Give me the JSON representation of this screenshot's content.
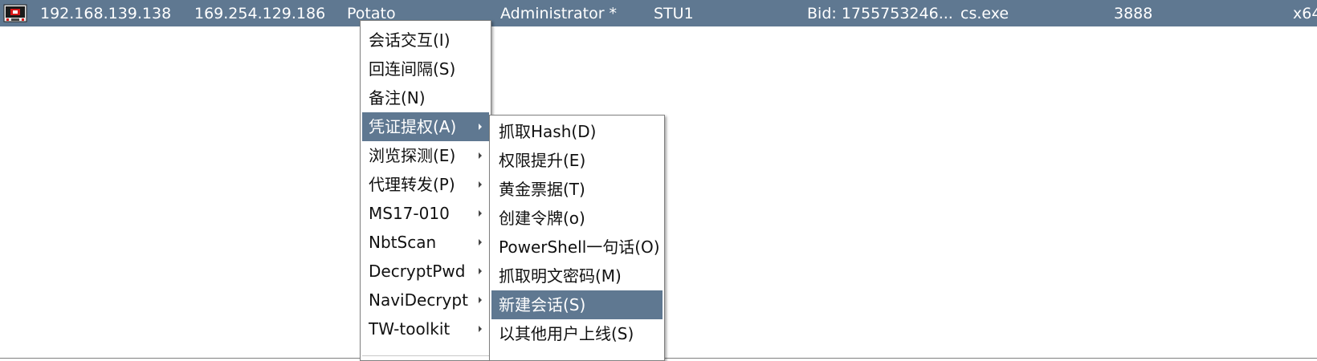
{
  "colors": {
    "selection": "#5f7891",
    "menu_background": "#ffffff",
    "menu_border": "#808080"
  },
  "session": {
    "icon": "computer-icon",
    "external_ip": "192.168.139.138",
    "internal_ip": "169.254.129.186",
    "listener": "Potato",
    "user": "Administrator *",
    "computer": "STU1",
    "note": "Bid: 1755753246...",
    "process": "cs.exe",
    "pid": "3888",
    "arch": "x64"
  },
  "main_menu": {
    "items": [
      {
        "label": "会话交互(I)",
        "submenu": false
      },
      {
        "label": "回连间隔(S)",
        "submenu": false
      },
      {
        "label": "备注(N)",
        "submenu": false
      },
      {
        "label": "凭证提权(A)",
        "submenu": true
      },
      {
        "label": "浏览探测(E)",
        "submenu": true
      },
      {
        "label": "代理转发(P)",
        "submenu": true
      },
      {
        "label": "MS17-010",
        "submenu": true
      },
      {
        "label": "NbtScan",
        "submenu": true
      },
      {
        "label": "DecryptPwd",
        "submenu": true
      },
      {
        "label": "NaviDecrypt",
        "submenu": true
      },
      {
        "label": "TW-toolkit",
        "submenu": true
      }
    ],
    "active_index": 3
  },
  "sub_menu": {
    "items": [
      {
        "label": "抓取Hash(D)"
      },
      {
        "label": "权限提升(E)"
      },
      {
        "label": "黄金票据(T)"
      },
      {
        "label": "创建令牌(o)"
      },
      {
        "label": "PowerShell一句话(O)"
      },
      {
        "label": "抓取明文密码(M)"
      },
      {
        "label": "新建会话(S)"
      },
      {
        "label": "以其他用户上线(S)"
      }
    ],
    "active_index": 6
  }
}
